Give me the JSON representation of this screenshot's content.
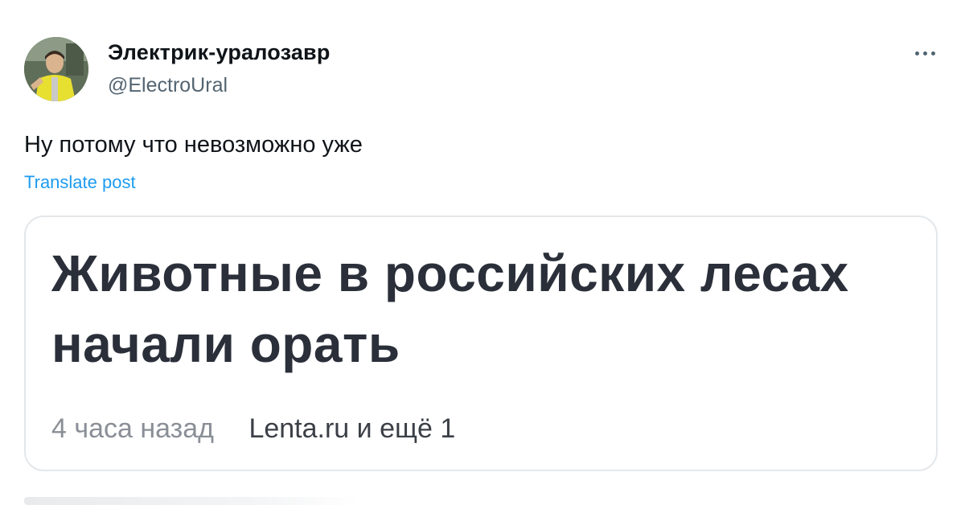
{
  "author": {
    "name": "Электрик-уралозавр",
    "handle": "@ElectroUral",
    "avatar_icon": "user-avatar-photo"
  },
  "post": {
    "text": "Ну потому что невозможно уже",
    "translate_label": "Translate post"
  },
  "card": {
    "headline": "Животные в российских лесах начали орать",
    "time": "4 часа назад",
    "source": "Lenta.ru и ещё 1"
  },
  "menu": {
    "icon": "more-horizontal-icon"
  },
  "colors": {
    "link": "#1d9bf0",
    "name": "#0f1419",
    "secondary": "#536471",
    "headline": "#2a2f3a"
  }
}
